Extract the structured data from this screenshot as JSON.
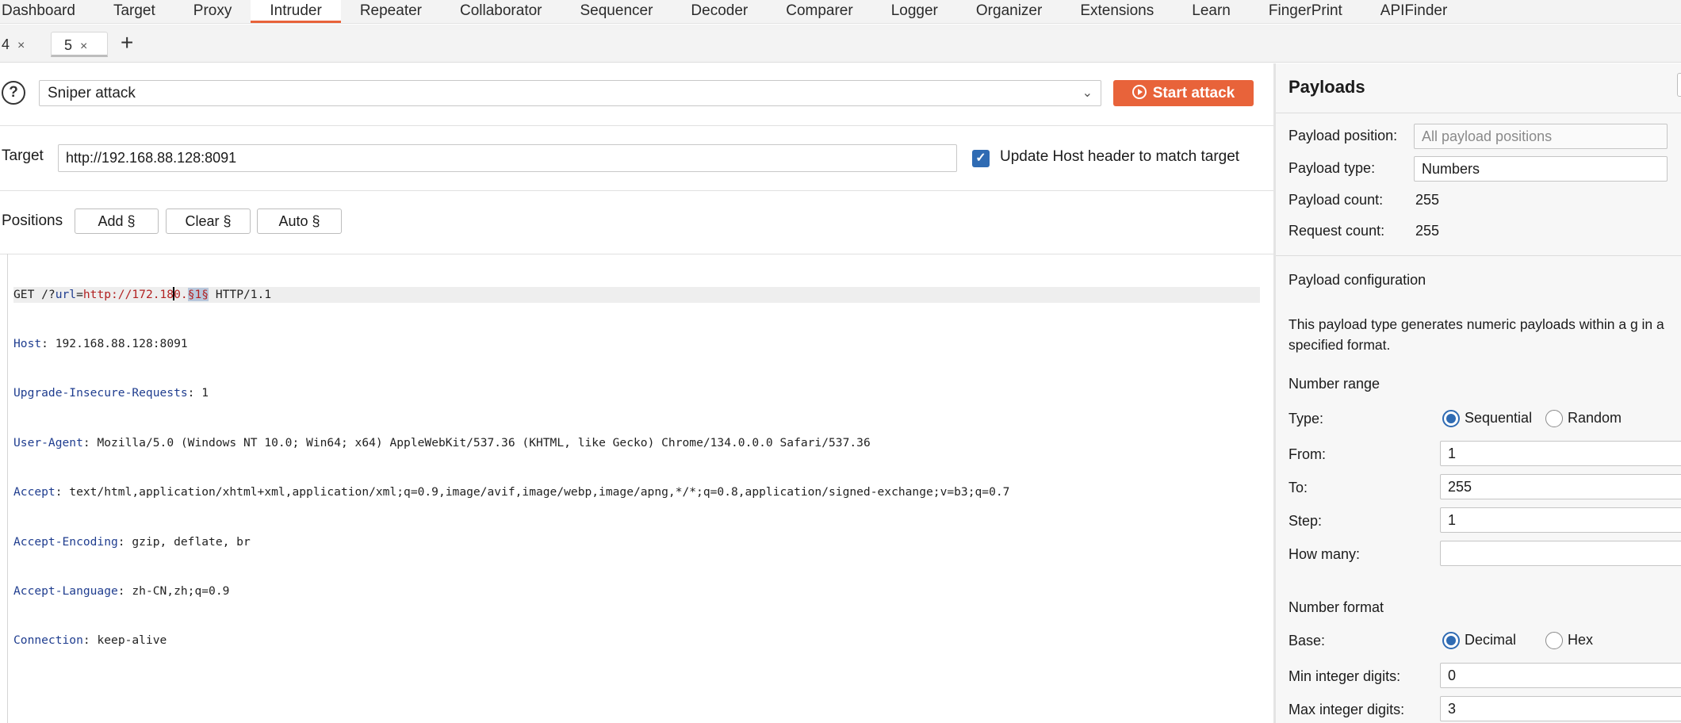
{
  "nav": {
    "items": [
      {
        "label": "Dashboard",
        "active": false
      },
      {
        "label": "Target",
        "active": false
      },
      {
        "label": "Proxy",
        "active": false
      },
      {
        "label": "Intruder",
        "active": true
      },
      {
        "label": "Repeater",
        "active": false
      },
      {
        "label": "Collaborator",
        "active": false
      },
      {
        "label": "Sequencer",
        "active": false
      },
      {
        "label": "Decoder",
        "active": false
      },
      {
        "label": "Comparer",
        "active": false
      },
      {
        "label": "Logger",
        "active": false
      },
      {
        "label": "Organizer",
        "active": false
      },
      {
        "label": "Extensions",
        "active": false
      },
      {
        "label": "Learn",
        "active": false
      },
      {
        "label": "FingerPrint",
        "active": false
      },
      {
        "label": "APIFinder",
        "active": false
      }
    ]
  },
  "tabs": {
    "items": [
      {
        "label": "4",
        "close": "×"
      },
      {
        "label": "5",
        "close": "×"
      }
    ],
    "add": "+"
  },
  "attack": {
    "help": "?",
    "type": "Sniper attack",
    "start_label": "Start attack"
  },
  "target": {
    "label": "Target",
    "url": "http://192.168.88.128:8091",
    "update_host_checked": true,
    "update_host_label": "Update Host header to match target"
  },
  "positions": {
    "label": "Positions",
    "add": "Add §",
    "clear": "Clear §",
    "auto": "Auto §"
  },
  "request": {
    "line1": {
      "method": "GET /?",
      "param": "url",
      "eq": "=",
      "value_a": "http://172.18",
      "value_b": "0.",
      "marker": "§1§",
      "rest": " HTTP/1.1"
    },
    "headers": [
      {
        "name": "Host",
        "value": " 192.168.88.128:8091"
      },
      {
        "name": "Upgrade-Insecure-Requests",
        "value": " 1"
      },
      {
        "name": "User-Agent",
        "value": " Mozilla/5.0 (Windows NT 10.0; Win64; x64) AppleWebKit/537.36 (KHTML, like Gecko) Chrome/134.0.0.0 Safari/537.36"
      },
      {
        "name": "Accept",
        "value": " text/html,application/xhtml+xml,application/xml;q=0.9,image/avif,image/webp,image/apng,*/*;q=0.8,application/signed-exchange;v=b3;q=0.7"
      },
      {
        "name": "Accept-Encoding",
        "value": " gzip, deflate, br"
      },
      {
        "name": "Accept-Language",
        "value": " zh-CN,zh;q=0.9"
      },
      {
        "name": "Connection",
        "value": " keep-alive"
      }
    ]
  },
  "payloads": {
    "title": "Payloads",
    "position_label": "Payload position:",
    "position_value": "All payload positions",
    "type_label": "Payload type:",
    "type_value": "Numbers",
    "count_label": "Payload count:",
    "count_value": "255",
    "request_label": "Request count:",
    "request_value": "255"
  },
  "config": {
    "title": "Payload configuration",
    "description": "This payload type generates numeric payloads within a g in a specified format.",
    "range_title": "Number range",
    "type_label": "Type:",
    "sequential": "Sequential",
    "random": "Random",
    "sequential_selected": true,
    "from_label": "From:",
    "from_value": "1",
    "to_label": "To:",
    "to_value": "255",
    "step_label": "Step:",
    "step_value": "1",
    "howmany_label": "How many:",
    "howmany_value": "",
    "format_title": "Number format",
    "base_label": "Base:",
    "decimal": "Decimal",
    "hex": "Hex",
    "decimal_selected": true,
    "min_int_label": "Min integer digits:",
    "min_int_value": "0",
    "max_int_label": "Max integer digits:",
    "max_int_value": "3"
  },
  "colors": {
    "accent": "#e8633a",
    "checkbox": "#2f6bb3",
    "header_name": "#1f3d8f",
    "param_value": "#b22222"
  }
}
